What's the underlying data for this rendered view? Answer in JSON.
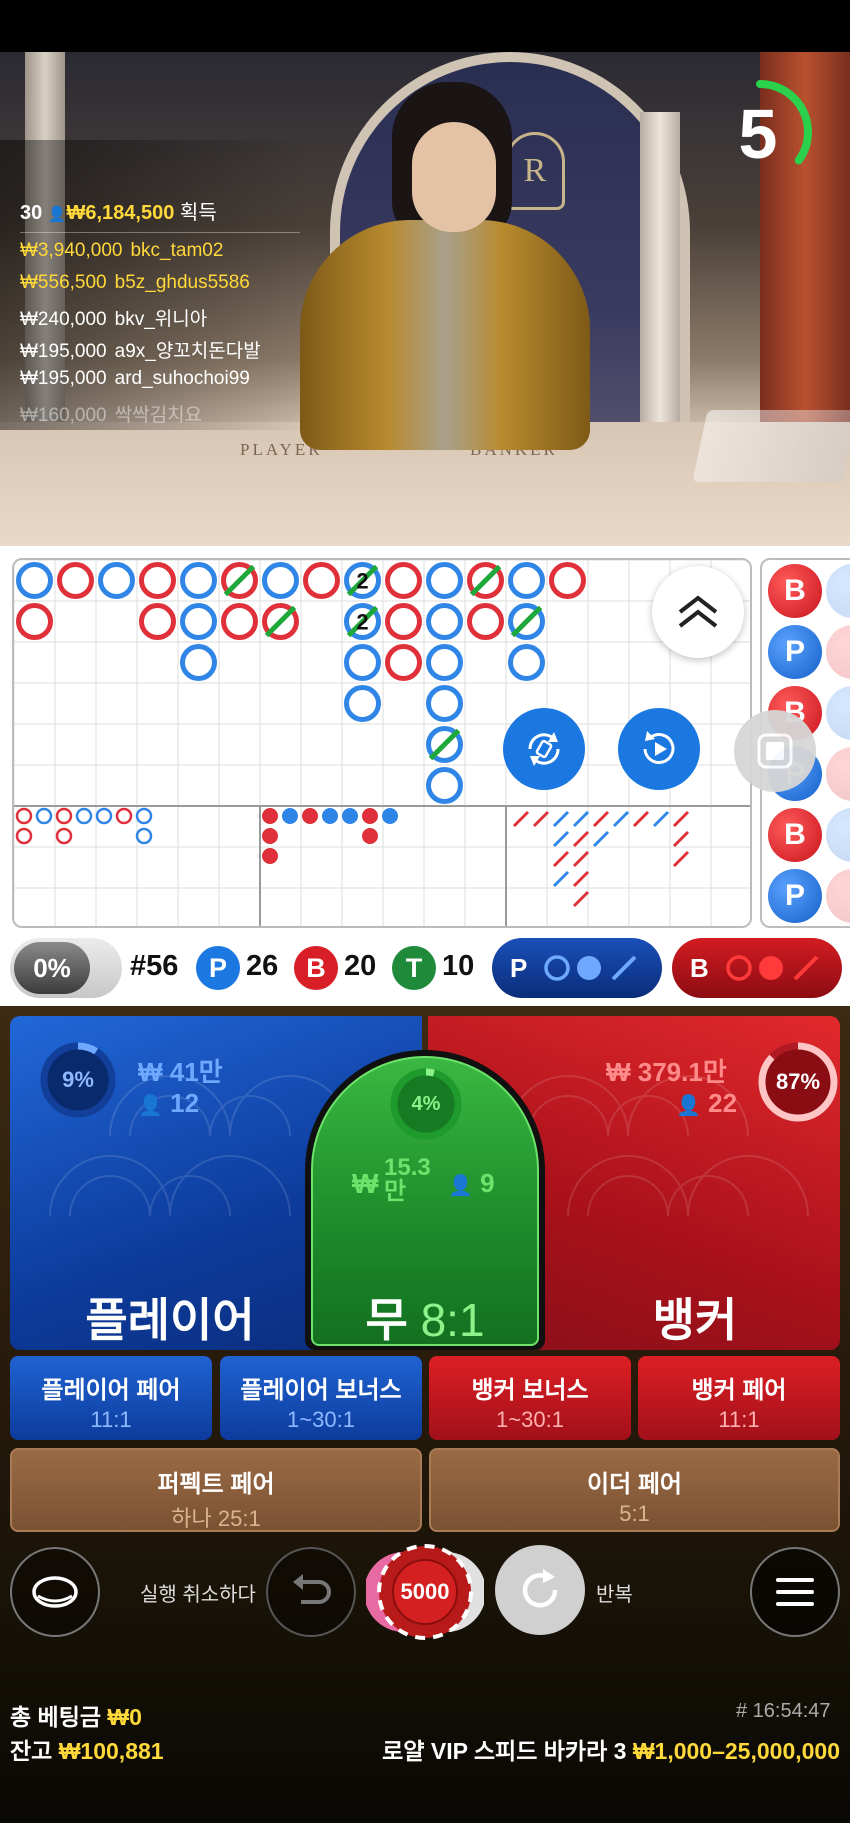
{
  "timer": {
    "seconds": "5",
    "progress": 0.35,
    "color": "#2bd14a"
  },
  "bet_feed": {
    "players": "30",
    "total": "₩6,184,500",
    "label": "획득",
    "rows": [
      {
        "amount": "₩3,940,000",
        "name": "bkc_tam02",
        "highlight": true
      },
      {
        "amount": "₩556,500",
        "name": "b5z_ghdus5586",
        "highlight": true
      },
      {
        "amount": "₩240,000",
        "name": "bkv_위니아",
        "highlight": false
      },
      {
        "amount": "₩195,000",
        "name": "a9x_양꼬치돈다발",
        "highlight": false
      },
      {
        "amount": "₩195,000",
        "name": "ard_suhochoi99",
        "highlight": false
      },
      {
        "amount": "₩160,000",
        "name": "싹싹김치요",
        "highlight": false
      }
    ]
  },
  "video": {
    "table_player": "PLAYER",
    "table_banker": "BANKER",
    "emblem": "R"
  },
  "roadmap": {
    "big_road": [
      [
        {
          "c": "p"
        },
        {
          "c": "b"
        }
      ],
      [
        {
          "c": "b"
        }
      ],
      [
        {
          "c": "p"
        }
      ],
      [
        {
          "c": "b"
        },
        {
          "c": "b"
        }
      ],
      [
        {
          "c": "p"
        },
        {
          "c": "p"
        },
        {
          "c": "p"
        }
      ],
      [
        {
          "c": "b",
          "tie": true
        },
        {
          "c": "b"
        }
      ],
      [
        {
          "c": "p"
        },
        {
          "c": "b",
          "tie": true
        }
      ],
      [
        {
          "c": "b"
        }
      ],
      [
        {
          "c": "p",
          "label": "2",
          "tie": true
        },
        {
          "c": "p",
          "label": "2",
          "tie": true
        },
        {
          "c": "p"
        },
        {
          "c": "p"
        }
      ],
      [
        {
          "c": "b"
        },
        {
          "c": "b"
        },
        {
          "c": "b"
        }
      ],
      [
        {
          "c": "p"
        },
        {
          "c": "p"
        },
        {
          "c": "p"
        },
        {
          "c": "p"
        },
        {
          "c": "p",
          "tie": true
        },
        {
          "c": "p"
        }
      ],
      [
        {
          "c": "b",
          "tie": true
        },
        {
          "c": "b"
        }
      ],
      [
        {
          "c": "p"
        },
        {
          "c": "p",
          "tie": true
        },
        {
          "c": "p"
        }
      ],
      [
        {
          "c": "b"
        }
      ]
    ],
    "side_beads": [
      "B",
      "P",
      "B",
      "P",
      "B",
      "P"
    ]
  },
  "stats": {
    "percent": "0%",
    "round": "#56",
    "player_letter": "P",
    "player_count": "26",
    "banker_letter": "B",
    "banker_count": "20",
    "tie_letter": "T",
    "tie_count": "10",
    "pred_player": "P",
    "pred_banker": "B"
  },
  "bets": {
    "player": {
      "percent": "9%",
      "pct_value": 9,
      "amount": "₩ 41만",
      "users": "12",
      "label": "플레이어"
    },
    "tie": {
      "percent": "4%",
      "pct_value": 4,
      "amount": "₩15.3\n만",
      "amount_top": "15.3",
      "amount_unit": "만",
      "currency": "₩",
      "users": "9",
      "label": "무",
      "odds": "8:1"
    },
    "banker": {
      "percent": "87%",
      "pct_value": 87,
      "amount": "₩ 379.1만",
      "users": "22",
      "label": "뱅커"
    },
    "side": [
      {
        "label": "플레이어 페어",
        "odds": "11:1",
        "color": "blue"
      },
      {
        "label": "플레이어 보너스",
        "odds": "1~30:1",
        "color": "blue"
      },
      {
        "label": "뱅커 보너스",
        "odds": "1~30:1",
        "color": "red"
      },
      {
        "label": "뱅커 페어",
        "odds": "11:1",
        "color": "red"
      }
    ],
    "pairs": [
      {
        "label": "퍼펙트 페어",
        "odds": "하나 25:1"
      },
      {
        "label": "이더 페어",
        "odds": "5:1"
      }
    ]
  },
  "controls": {
    "undo_label": "실행 취소하다",
    "chip_value": "5000",
    "repeat_label": "반복"
  },
  "footer": {
    "total_bet_label": "총 베팅금",
    "total_bet_value": "₩0",
    "balance_label": "잔고",
    "balance_value": "₩100,881",
    "table_name": "로얄 VIP 스피드 바카라 3",
    "limits": "₩1,000–25,000,000",
    "time": "# 16:54:47"
  },
  "colors": {
    "player": "#1b6be0",
    "banker": "#d81e27",
    "tie": "#1fa83a",
    "gold": "#ffd83a"
  }
}
